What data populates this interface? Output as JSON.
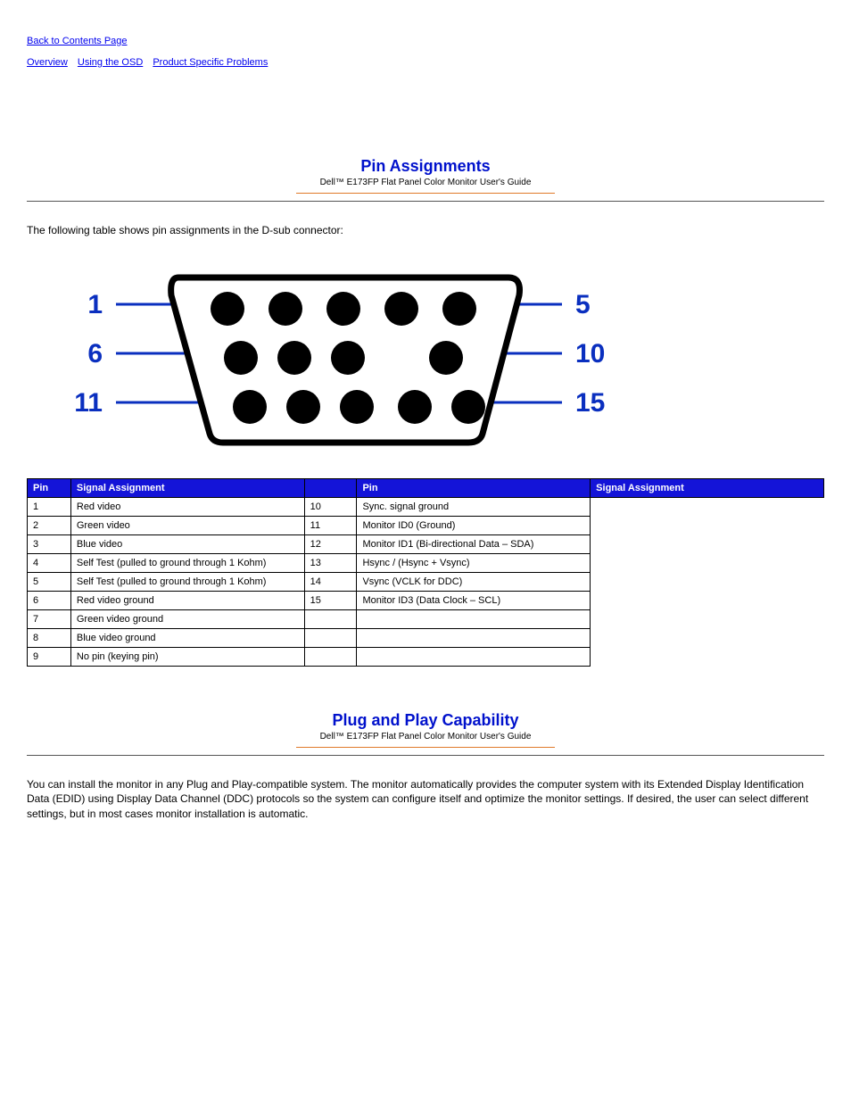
{
  "top_nav": {
    "back": "Back to Contents Page",
    "links": [
      "Overview",
      "Using the OSD",
      "Product Specific Problems"
    ]
  },
  "section1": {
    "title": "Pin Assignments",
    "subtitle": "Dell™ E173FP Flat Panel Color Monitor User's Guide",
    "body": "The following table shows pin assignments in the D-sub connector:",
    "connector_labels": {
      "p1": "1",
      "p5": "5",
      "p6": "6",
      "p10": "10",
      "p11": "11",
      "p15": "15"
    },
    "table_headers": {
      "pin": "Pin",
      "signal": "Signal Assignment"
    },
    "pins_left": [
      {
        "pin": "1",
        "sig": "Red video"
      },
      {
        "pin": "2",
        "sig": "Green video"
      },
      {
        "pin": "3",
        "sig": "Blue video"
      },
      {
        "pin": "4",
        "sig": "Self Test (pulled to ground through 1 Kohm)"
      },
      {
        "pin": "5",
        "sig": "Self Test (pulled to ground through 1 Kohm)"
      },
      {
        "pin": "6",
        "sig": "Red video ground"
      },
      {
        "pin": "7",
        "sig": "Green video ground"
      },
      {
        "pin": "8",
        "sig": "Blue video ground"
      },
      {
        "pin": "9",
        "sig": "No pin (keying pin)"
      }
    ],
    "pins_right": [
      {
        "pin": "10",
        "sig": "Sync. signal ground"
      },
      {
        "pin": "11",
        "sig": "Monitor ID0 (Ground)"
      },
      {
        "pin": "12",
        "sig": "Monitor ID1 (Bi-directional Data – SDA)"
      },
      {
        "pin": "13",
        "sig": "Hsync / (Hsync + Vsync)"
      },
      {
        "pin": "14",
        "sig": "Vsync (VCLK for DDC)"
      },
      {
        "pin": "15",
        "sig": "Monitor ID3 (Data Clock – SCL)"
      },
      {
        "pin": "",
        "sig": ""
      },
      {
        "pin": "",
        "sig": ""
      }
    ]
  },
  "section2": {
    "title": "Plug and Play Capability",
    "subtitle": "Dell™ E173FP Flat Panel Color Monitor User's Guide",
    "body": "You can install the monitor in any Plug and Play-compatible system. The monitor automatically provides the computer system with its Extended Display Identification Data (EDID) using Display Data Channel (DDC) protocols so the system can configure itself and optimize the monitor settings. If desired, the user can select different settings, but in most cases monitor installation is automatic."
  }
}
